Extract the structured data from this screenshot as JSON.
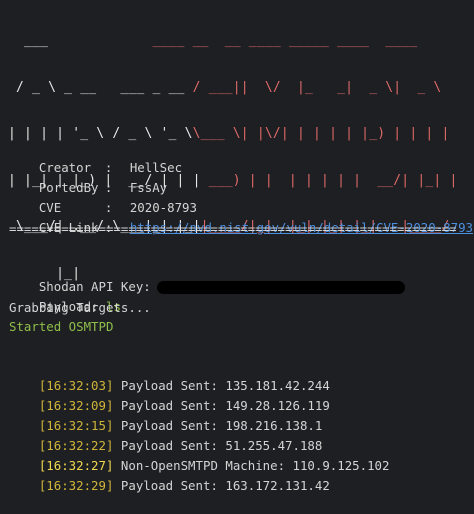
{
  "banner": {
    "part_white": [
      "  ___             ",
      " / _ \\ _ __   ___ _ __ ",
      "| | | | '_ \\ / _ \\ '_ \\",
      "| |_| | |_) |  __/ | | |",
      " \\___/| .__/ \\___|_| |_|",
      "      |_|"
    ],
    "part_red": [
      "____ __  __ ____ _____ ____  ____  ",
      "/ ___||  \\/  |_   _|  _ \\|  _ \\ ",
      "\\___ \\| |\\/| | | | | |_) | | | |",
      " ___) | |  | | | | |  __/| |_| |",
      "|____/|_|  |_| |_| |_|   |____/ ",
      ""
    ]
  },
  "info": {
    "creator_key": "Creator",
    "creator_value": "HellSec",
    "ported_key": "PortedBy",
    "ported_value": "FssAy",
    "cve_key": "CVE",
    "cve_value": "2020-8793",
    "link_key": "CVE Link",
    "link_value": "https://nvd.nist.gov/vuln/detail/CVE-2020-8793",
    "separator": ":"
  },
  "rule": "=====================================================================",
  "prompt": {
    "api_key_label": "Shodan API Key:",
    "payload_label": "Payload:",
    "payload_value": "ls",
    "grabbing": "Grabbing Targets...",
    "started": "Started OSMTPD"
  },
  "log": [
    {
      "time": "[16:32:03]",
      "message": "Payload Sent: 135.181.42.244"
    },
    {
      "time": "[16:32:09]",
      "message": "Payload Sent: 149.28.126.119"
    },
    {
      "time": "[16:32:15]",
      "message": "Payload Sent: 198.216.138.1"
    },
    {
      "time": "[16:32:22]",
      "message": "Payload Sent: 51.255.47.188"
    },
    {
      "time": "[16:32:27]",
      "message": "Non-OpenSMTPD Machine: 110.9.125.102"
    },
    {
      "time": "[16:32:29]",
      "message": "Payload Sent: 163.172.131.42"
    }
  ],
  "colors": {
    "background": "#1e1f22",
    "text": "#d4d4d4",
    "accent_red": "#e06a6a",
    "link": "#4b8fe0",
    "green": "#8fbf4a",
    "timestamp": "#d0b53a",
    "timestamp_highlight": "#f2d94e"
  }
}
